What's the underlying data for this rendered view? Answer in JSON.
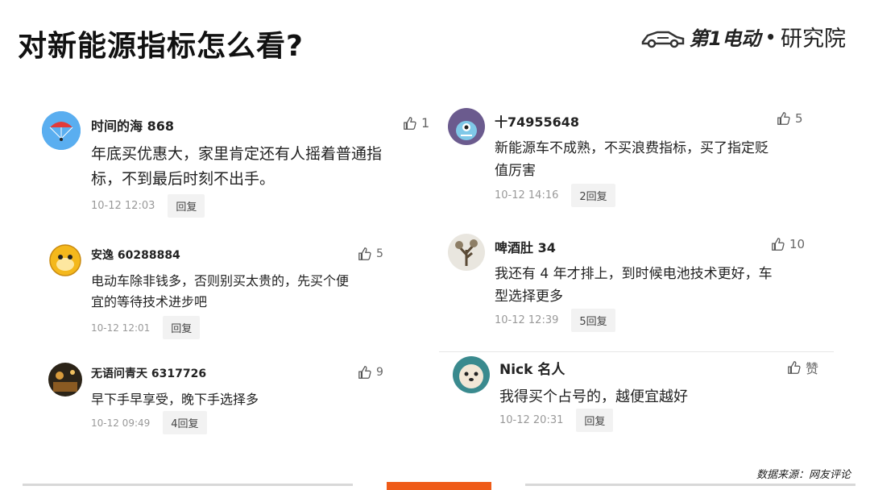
{
  "page": {
    "title": "对新能源指标怎么看?",
    "brand_text": "第1电动",
    "brand_sep": "•",
    "brand_suffix": "研究院",
    "source": "数据来源：网友评论"
  },
  "colors": {
    "accent": "#ef5b18",
    "reply_bg": "#f2f2f2",
    "meta": "#999999"
  },
  "comments": [
    {
      "user": "时间的海 868",
      "likes": "1",
      "text": "年底买优惠大，家里肯定还有人摇着普通指\n标，不到最后时刻不出手。",
      "time": "10-12 12:03",
      "reply": "回复",
      "avatar_icon": "parachute-avatar"
    },
    {
      "user": "安逸 60288884",
      "likes": "5",
      "text": "电动车除非钱多，否则别买太贵的，先买个便\n宜的等待技术进步吧",
      "time": "10-12 12:01",
      "reply": "回复",
      "avatar_icon": "cartoon-monkey-avatar"
    },
    {
      "user": "无语问青天 6317726",
      "likes": "9",
      "text": "早下手早享受，晚下手选择多",
      "time": "10-12 09:49",
      "reply": "4回复",
      "avatar_icon": "night-scene-avatar"
    },
    {
      "user": "十74955648",
      "likes": "5",
      "text": "新能源车不成熟，不买浪费指标，买了指定贬\n值厉害",
      "time": "10-12 14:16",
      "reply": "2回复",
      "avatar_icon": "blue-creature-avatar"
    },
    {
      "user": "啤酒肚 34",
      "likes": "10",
      "text": "我还有 4 年才排上，到时候电池技术更好，车\n型选择更多",
      "time": "10-12 12:39",
      "reply": "5回复",
      "avatar_icon": "tree-avatar"
    },
    {
      "user": "Nick 名人",
      "likes": "赞",
      "text": "我得买个占号的，越便宜越好",
      "time": "10-12 20:31",
      "reply": "回复",
      "avatar_icon": "puppy-avatar"
    }
  ]
}
